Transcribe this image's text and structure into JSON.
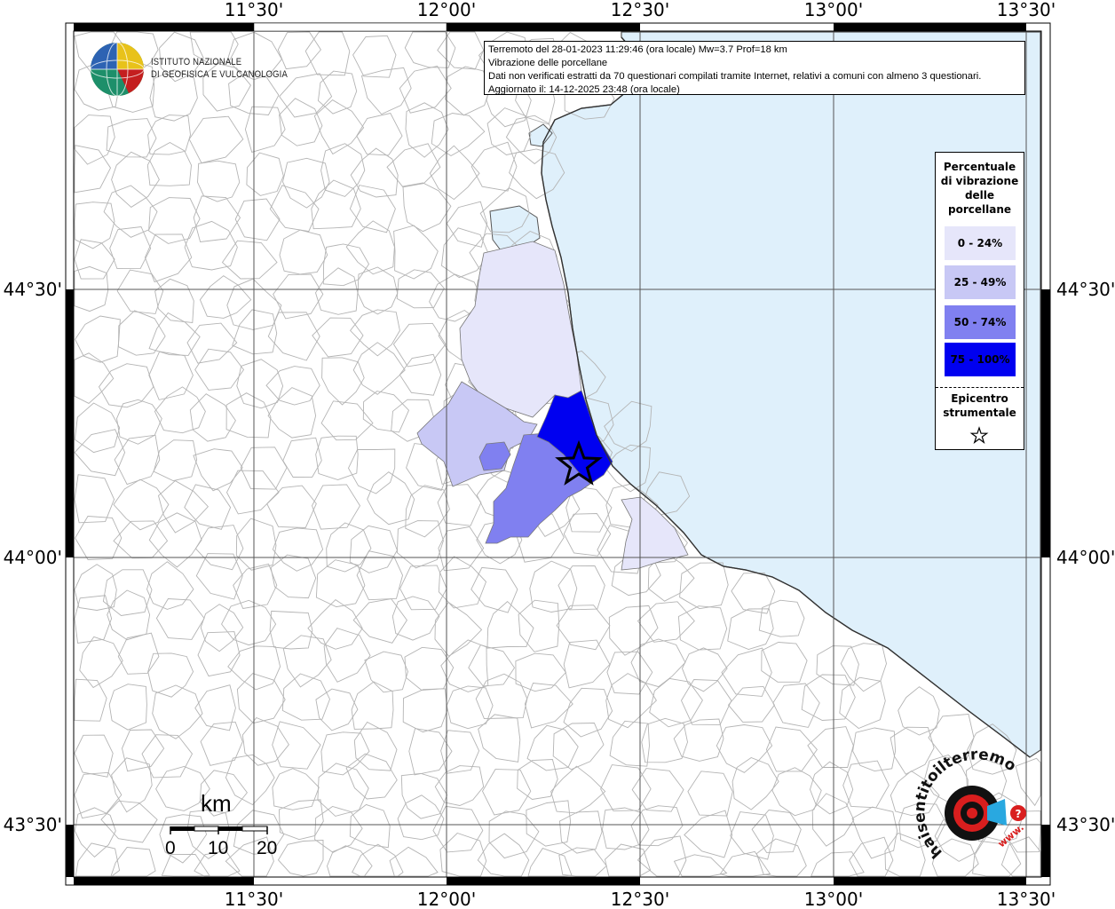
{
  "info": {
    "line1": "Terremoto del 28-01-2023 11:29:46 (ora locale) Mw=3.7 Prof=18 km",
    "line2": "Vibrazione delle porcellane",
    "line3": "Dati non verificati estratti da 70 questionari compilati tramite Internet, relativi a comuni con almeno 3 questionari.",
    "line4": "Aggiornato il: 14-12-2025 23:48 (ora locale)"
  },
  "logo": {
    "line1": "ISTITUTO NAZIONALE",
    "line2": "DI GEOFISICA E VULCANOLOGIA"
  },
  "axes": {
    "lon_ticks": [
      "11°30'",
      "12°00'",
      "12°30'",
      "13°00'",
      "13°30'"
    ],
    "lat_ticks": [
      "44°30'",
      "44°00'",
      "43°30'"
    ]
  },
  "legend": {
    "title_lines": [
      "Percentuale",
      "di vibrazione",
      "delle",
      "porcellane"
    ],
    "classes": [
      {
        "label": "0 - 24%",
        "color": "#e6e6fa"
      },
      {
        "label": "25 - 49%",
        "color": "#c8c8f5"
      },
      {
        "label": "50 - 74%",
        "color": "#8080f0"
      },
      {
        "label": "75 - 100%",
        "color": "#0000f0"
      }
    ],
    "epicenter_lines": [
      "Epicentro",
      "strumentale"
    ]
  },
  "scale": {
    "unit": "km",
    "labels": [
      "0",
      "10",
      "20"
    ]
  },
  "watermark": {
    "text": "haisentitoilterremoto.it",
    "sub": "www."
  },
  "colors": {
    "sea": "#dff0fb",
    "land": "#ffffff",
    "boundary": "#b4b4b4"
  }
}
